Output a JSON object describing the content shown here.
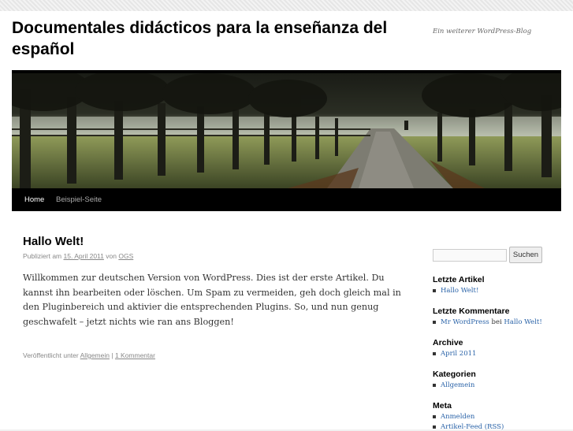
{
  "site": {
    "title": "Documentales didácticos para la enseñanza del español",
    "description": "Ein weiterer WordPress-Blog"
  },
  "nav": {
    "items": [
      "Home",
      "Beispiel-Seite"
    ]
  },
  "post": {
    "title": "Hallo Welt!",
    "meta_prefix": "Publiziert am",
    "date": "15. April 2011",
    "meta_by": "von",
    "author": "OGS",
    "body": "Willkommen zur deutschen Version von WordPress. Dies ist der erste Artikel. Du kannst ihn bearbeiten oder löschen. Um Spam zu vermeiden, geh doch gleich mal in den Pluginbereich und aktivier die entsprechenden Plugins. So, und nun genug geschwafelt – jetzt nichts wie ran ans Bloggen!",
    "footer_prefix": "Veröffentlicht unter",
    "category": "Allgemein",
    "separator": "|",
    "comments": "1 Kommentar"
  },
  "sidebar": {
    "search_button": "Suchen",
    "search_value": "",
    "recent_posts": {
      "title": "Letzte Artikel",
      "items": [
        "Hallo Welt!"
      ]
    },
    "recent_comments": {
      "title": "Letzte Kommentare",
      "author": "Mr WordPress",
      "joiner": "bei",
      "post": "Hallo Welt!"
    },
    "archive": {
      "title": "Archive",
      "items": [
        "April 2011"
      ]
    },
    "categories": {
      "title": "Kategorien",
      "items": [
        "Allgemein"
      ]
    },
    "meta": {
      "title": "Meta",
      "items": [
        "Anmelden",
        "Artikel-Feed (RSS)"
      ]
    }
  },
  "colors": {
    "link": "#2a63a8",
    "nav_bg": "#000000"
  },
  "icons": {
    "list_bullet": "square-bullet-icon"
  }
}
